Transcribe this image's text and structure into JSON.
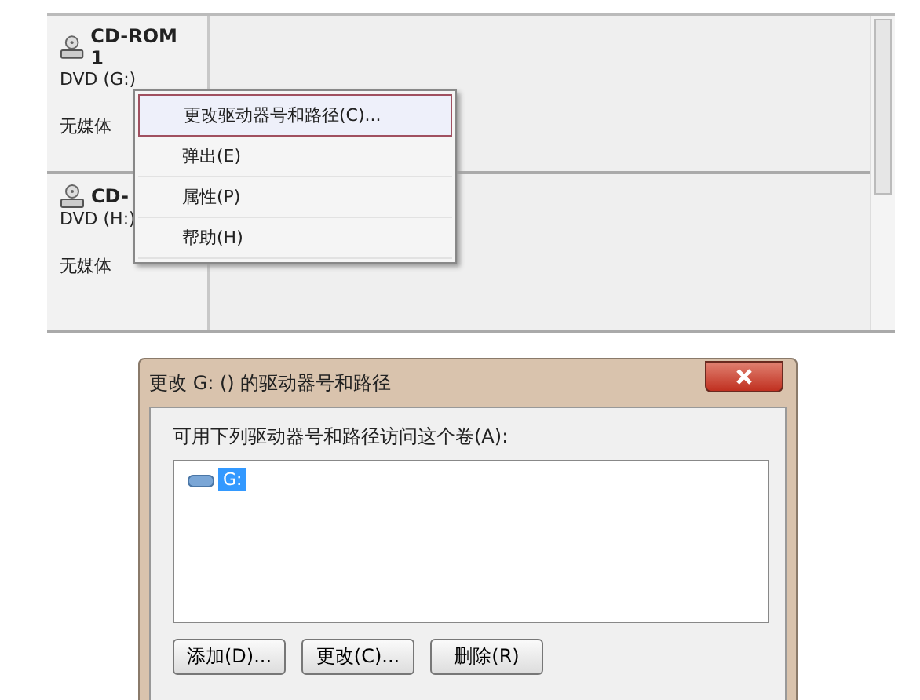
{
  "disk_panel": {
    "disks": [
      {
        "name": "CD-ROM 1",
        "drive": "DVD (G:)",
        "status": "无媒体"
      },
      {
        "name": "CD-",
        "drive": "DVD (H:)",
        "status": "无媒体"
      }
    ]
  },
  "context_menu": {
    "items": [
      {
        "label": "更改驱动器号和路径(C)...",
        "selected": true
      },
      {
        "label": "弹出(E)",
        "selected": false
      },
      {
        "label": "属性(P)",
        "selected": false
      },
      {
        "label": "帮助(H)",
        "selected": false
      }
    ]
  },
  "dialog": {
    "title": "更改 G: () 的驱动器号和路径",
    "prompt": "可用下列驱动器号和路径访问这个卷(A):",
    "list": [
      {
        "label": "G:",
        "selected": true
      }
    ],
    "buttons": [
      "添加(D)...",
      "更改(C)...",
      "删除(R)"
    ]
  }
}
